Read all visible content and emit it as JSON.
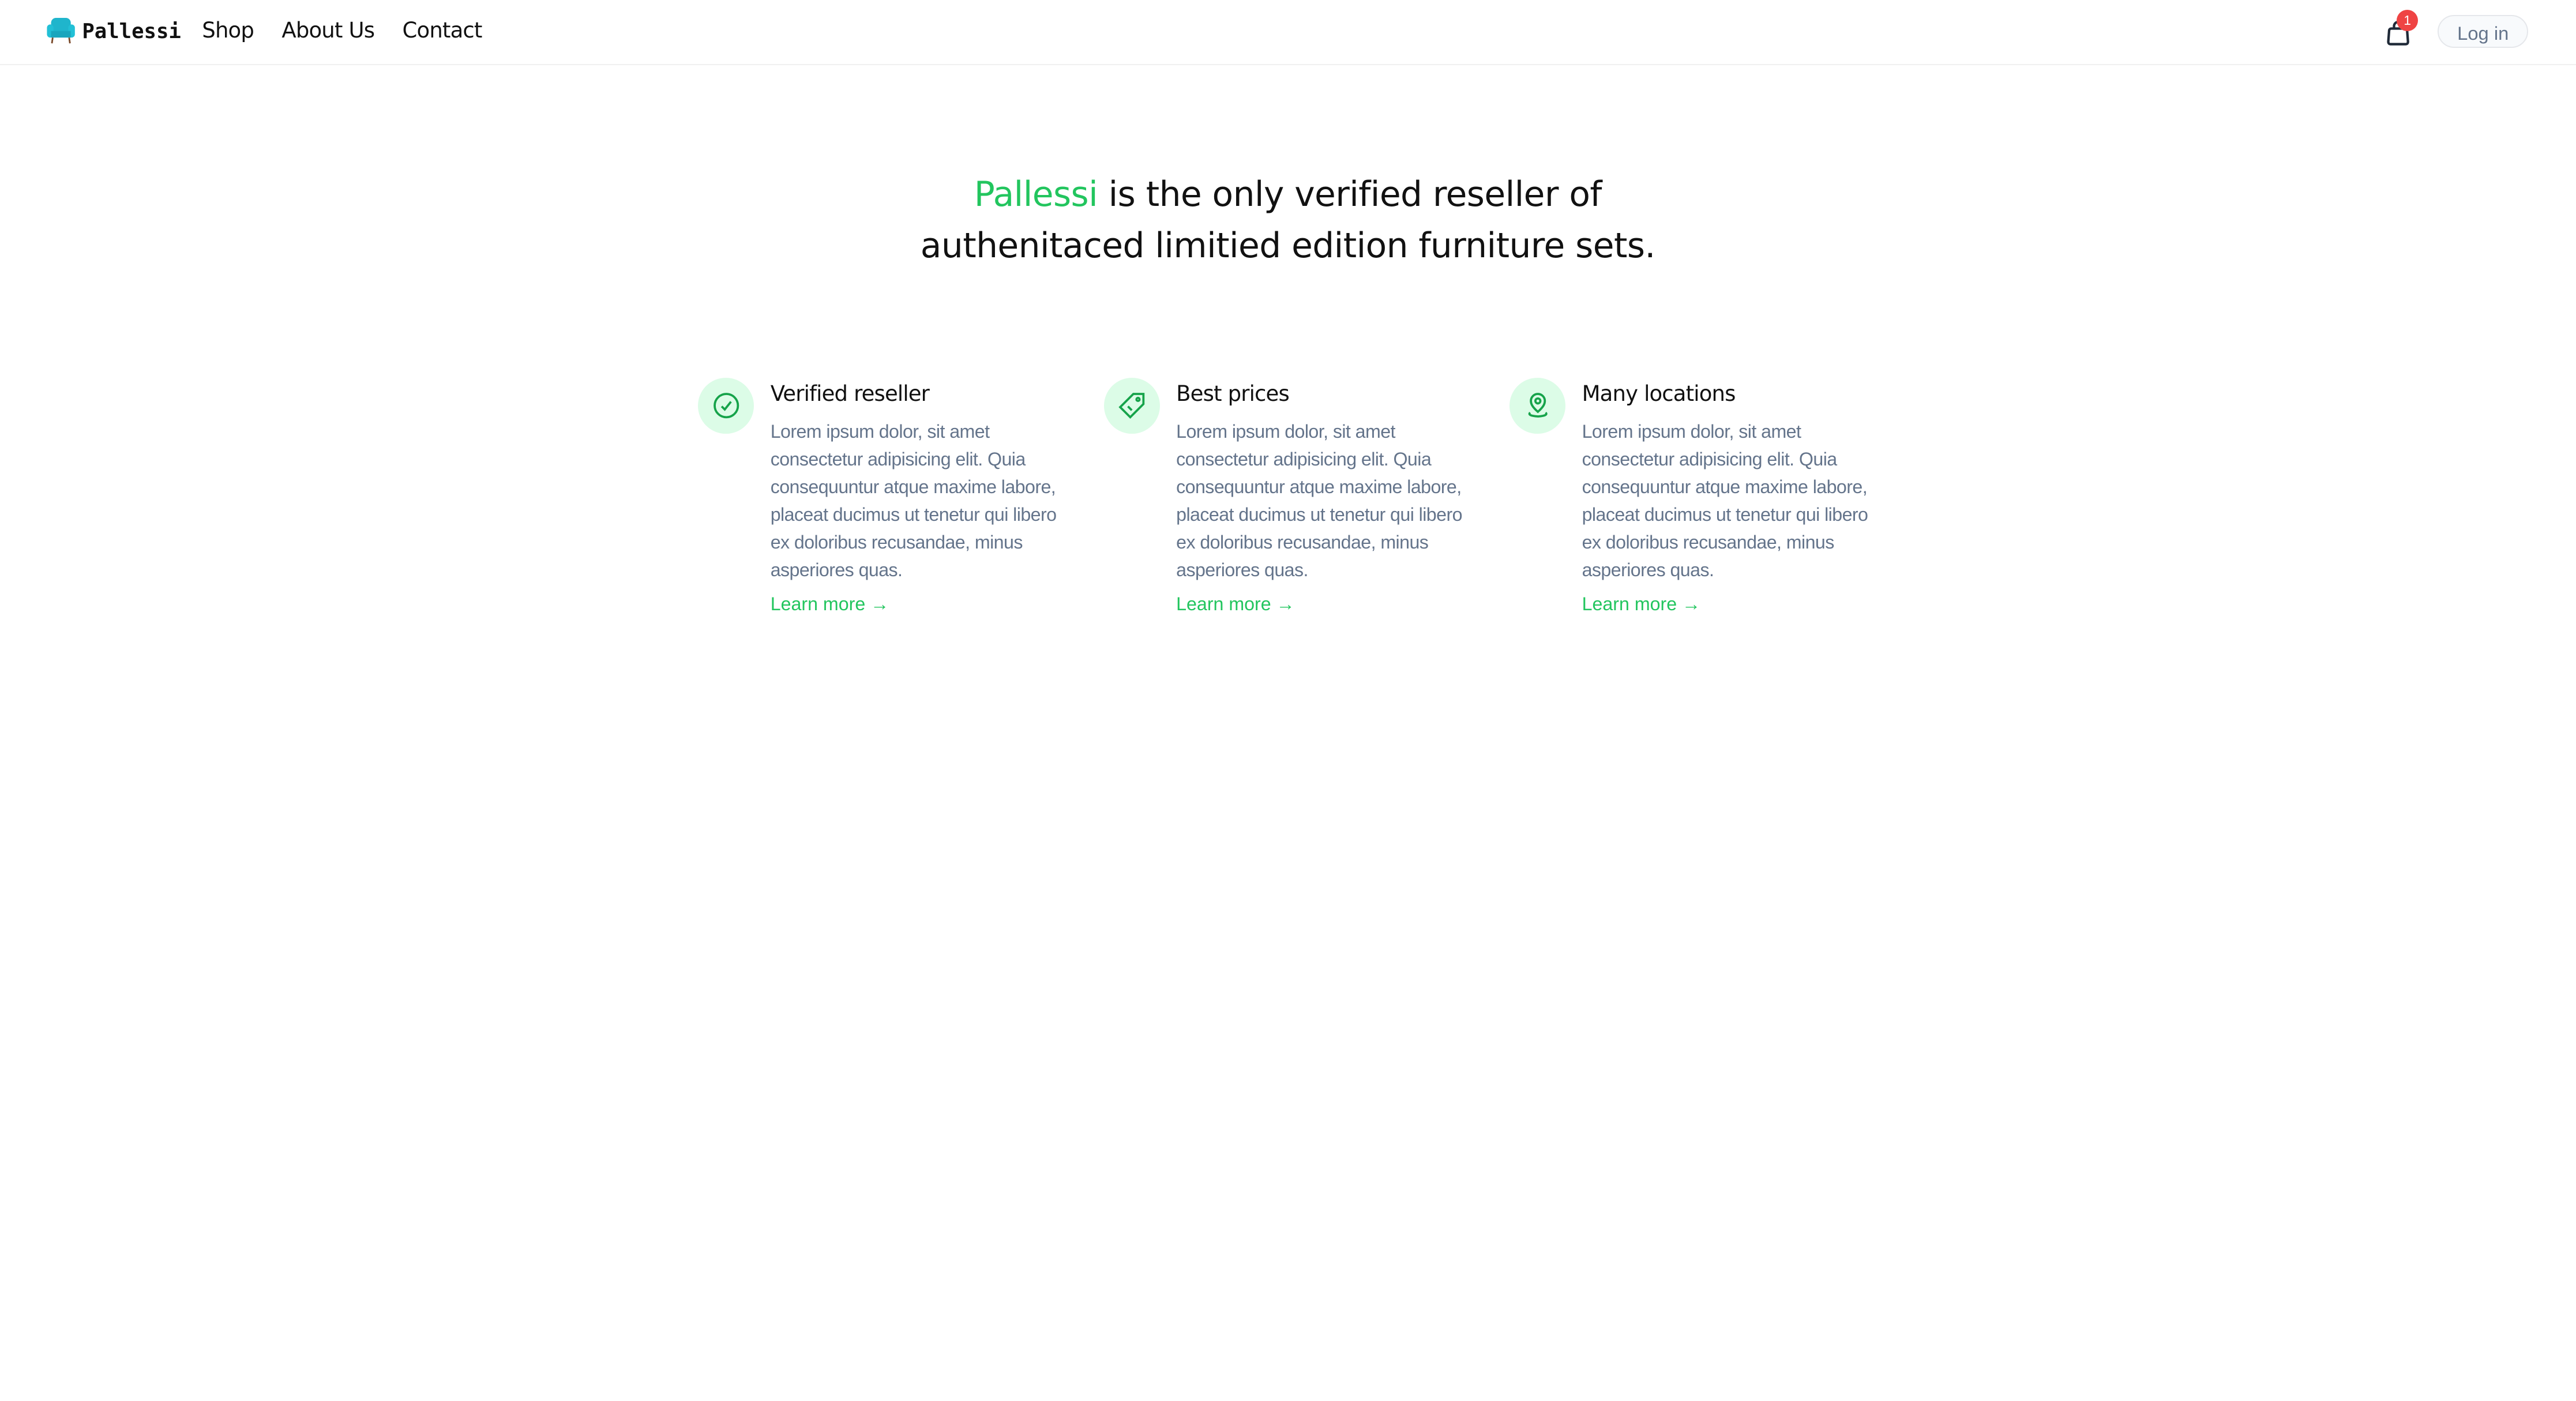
{
  "nav": {
    "brand": "Pallessi",
    "links": [
      "Shop",
      "About Us",
      "Contact"
    ],
    "cart_count": "1",
    "login_label": "Log in"
  },
  "hero": {
    "brand": "Pallessi",
    "line1_rest": " is the only verified reseller of",
    "line2": "authenitaced limitied edition furniture sets."
  },
  "features": [
    {
      "icon": "check-circle-icon",
      "title": "Verified reseller",
      "text": "Lorem ipsum dolor, sit amet consectetur adipisicing elit. Quia consequuntur atque maxime labore, placeat ducimus ut tenetur qui libero ex doloribus recusandae, minus asperiores quas.",
      "link": "Learn more →"
    },
    {
      "icon": "price-tag-icon",
      "title": "Best prices",
      "text": "Lorem ipsum dolor, sit amet consectetur adipisicing elit. Quia consequuntur atque maxime labore, placeat ducimus ut tenetur qui libero ex doloribus recusandae, minus asperiores quas.",
      "link": "Learn more →"
    },
    {
      "icon": "location-pin-icon",
      "title": "Many locations",
      "text": "Lorem ipsum dolor, sit amet consectetur adipisicing elit. Quia consequuntur atque maxime labore, placeat ducimus ut tenetur qui libero ex doloribus recusandae, minus asperiores quas.",
      "link": "Learn more →"
    }
  ],
  "colors": {
    "accent": "#22c55e",
    "badge": "#ef4444",
    "icon_bg": "#dcfce7"
  }
}
